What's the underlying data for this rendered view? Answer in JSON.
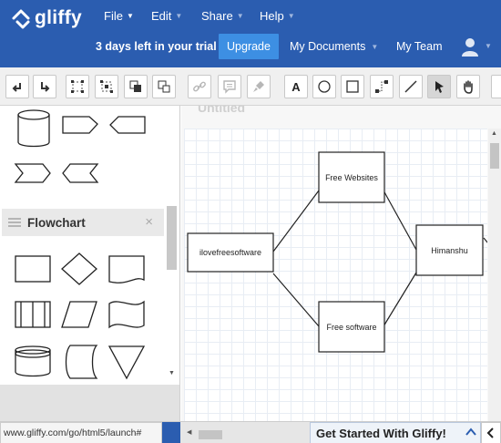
{
  "header": {
    "logo_text": "gliffy",
    "menus": [
      {
        "label": "File"
      },
      {
        "label": "Edit"
      },
      {
        "label": "Share"
      },
      {
        "label": "Help"
      }
    ],
    "trial_text": "3 days left in your trial",
    "upgrade_label": "Upgrade",
    "my_documents_label": "My Documents",
    "my_team_label": "My Team",
    "colors": {
      "bar": "#2b5db0",
      "upgrade": "#3d8fe3"
    }
  },
  "toolbar": {
    "icons": [
      "undo-icon",
      "redo-icon",
      "select-group-icon",
      "ungroup-icon",
      "bring-front-icon",
      "send-back-icon",
      "link-icon",
      "comment-icon",
      "format-painter-icon",
      "text-tool-icon",
      "ellipse-tool-icon",
      "rectangle-tool-icon",
      "connector-tool-icon",
      "line-tool-icon",
      "pointer-tool-icon",
      "pan-tool-icon"
    ]
  },
  "shape_library": {
    "section_title": "Flowchart",
    "close_glyph": "×"
  },
  "canvas": {
    "ghost_title": "Untitled",
    "nodes": {
      "left": "ilovefreesoftware",
      "top": "Free Websites",
      "bottom": "Free software",
      "right": "Himanshu"
    }
  },
  "footer": {
    "url": "www.gliffy.com/go/html5/launch#",
    "get_started_label": "Get Started With Gliffy!"
  }
}
